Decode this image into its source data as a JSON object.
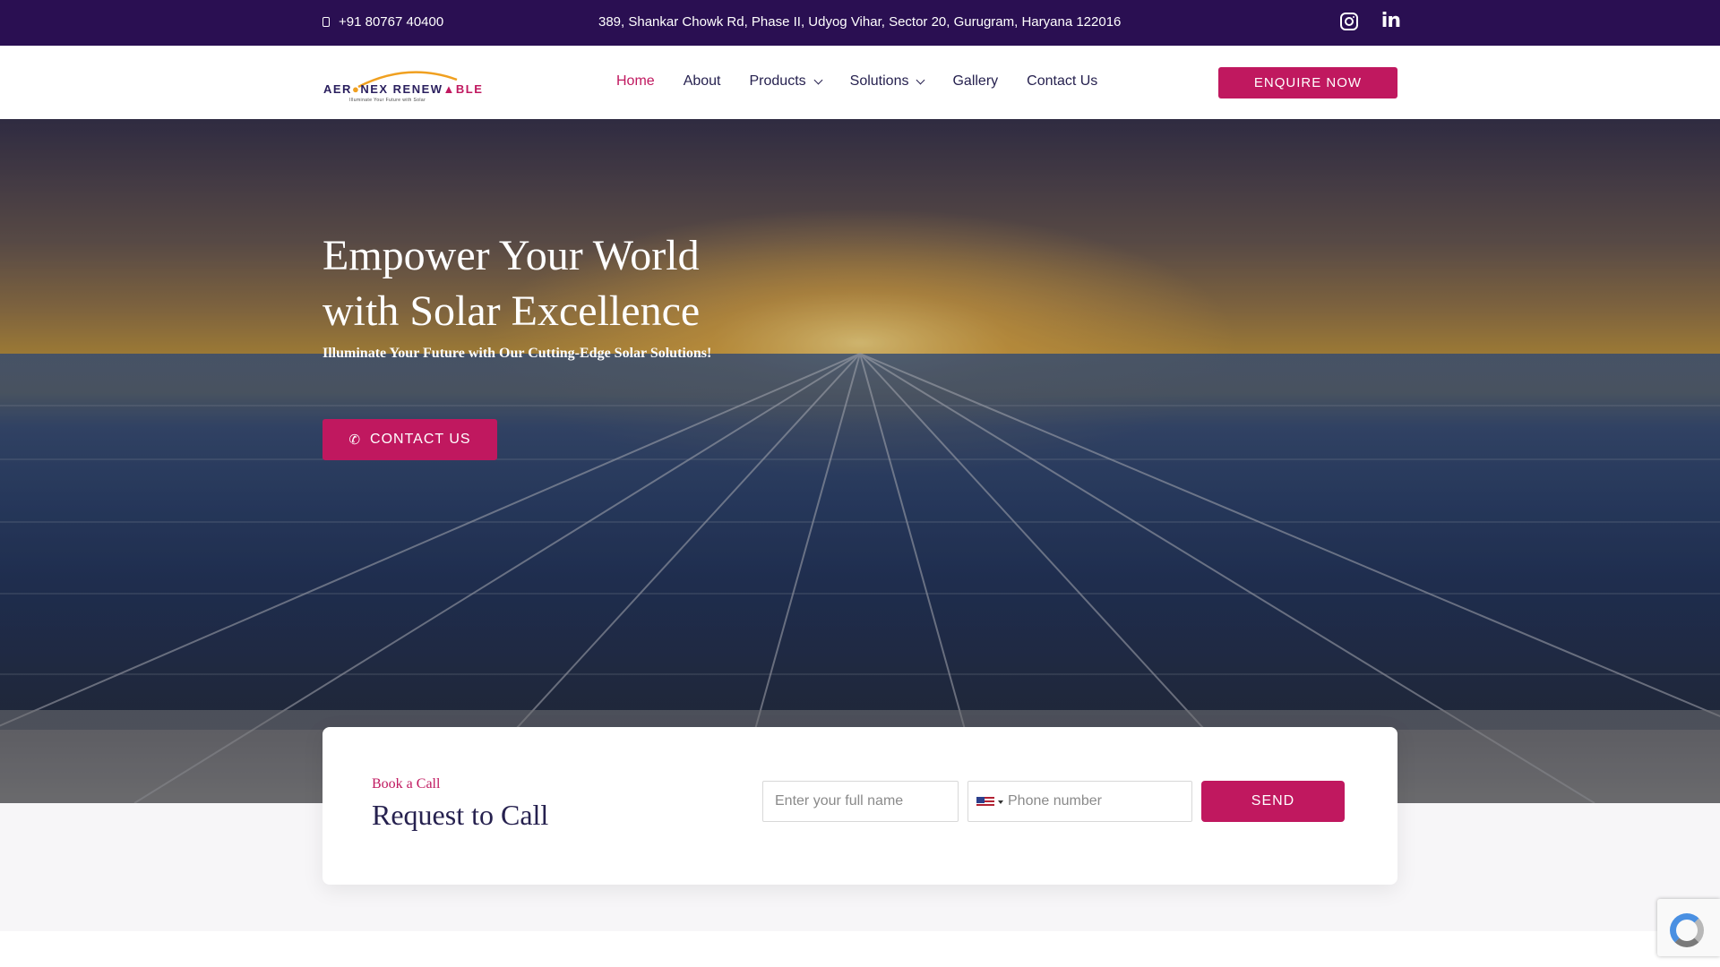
{
  "topbar": {
    "phone": "+91 80767 40400",
    "address": "389, Shankar Chowk Rd, Phase II, Udyog Vihar, Sector 20, Gurugram, Haryana 122016",
    "icons": [
      "phone-icon",
      "instagram-icon",
      "linkedin-icon"
    ],
    "linkedin_glyph": "in"
  },
  "logo": {
    "text_part1": "AER",
    "text_part2": "NEX RENEW",
    "text_part3": "BLE",
    "tagline": "Illuminate Your Future with Solar"
  },
  "nav": {
    "items": [
      {
        "label": "Home",
        "active": true
      },
      {
        "label": "About"
      },
      {
        "label": "Products",
        "dropdown": true
      },
      {
        "label": "Solutions",
        "dropdown": true
      },
      {
        "label": "Gallery"
      },
      {
        "label": "Contact Us"
      }
    ],
    "cta_label": "ENQUIRE NOW"
  },
  "hero": {
    "title_line1": "Empower Your World",
    "title_line2": "with Solar Excellence",
    "subtitle": "Illuminate Your Future with Our Cutting-Edge Solar Solutions!",
    "button_label": "CONTACT US"
  },
  "callback_form": {
    "eyebrow": "Book a Call",
    "title": "Request to Call",
    "name_placeholder": "Enter your full name",
    "phone_placeholder": "Phone number",
    "country_flag": "US",
    "send_label": "SEND"
  },
  "colors": {
    "topbar_bg": "#2a0f52",
    "accent": "#c0185f",
    "text_dark": "#26214f"
  }
}
